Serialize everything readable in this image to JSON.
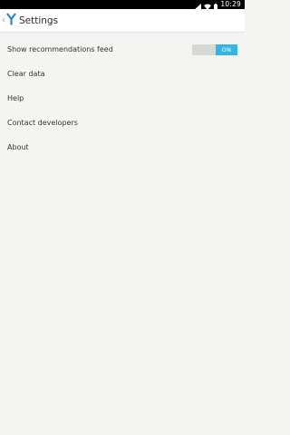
{
  "status_bar": {
    "time": "10:29",
    "icons": [
      "signal-icon",
      "wifi-icon",
      "battery-icon"
    ]
  },
  "action_bar": {
    "title": "Settings",
    "logo": "yandex-y-logo"
  },
  "settings": {
    "items": [
      {
        "label": "Show recommendations feed",
        "toggle": {
          "state": "ON",
          "on": true
        }
      },
      {
        "label": "Clear data"
      },
      {
        "label": "Help"
      },
      {
        "label": "Contact developers"
      },
      {
        "label": "About"
      }
    ]
  },
  "colors": {
    "accent": "#33b5e5",
    "logo": "#1e88e5",
    "background": "#f4f4f2"
  }
}
